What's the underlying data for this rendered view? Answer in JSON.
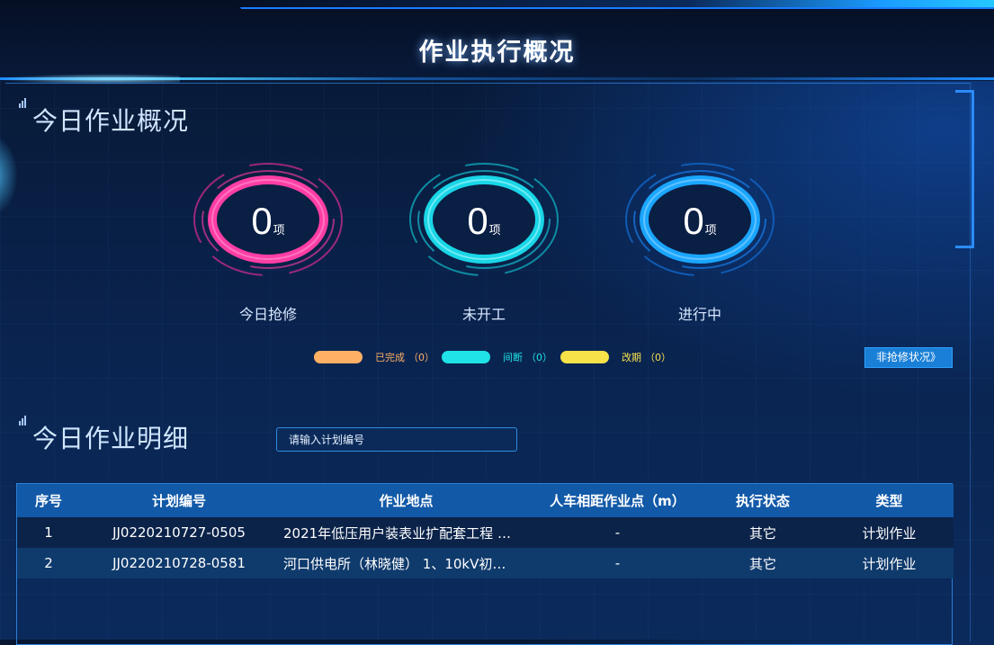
{
  "header": {
    "title": "作业执行概况"
  },
  "overview": {
    "title": "今日作业概况",
    "stats": [
      {
        "value": "0",
        "unit": "项",
        "label": "今日抢修",
        "color": "#ff3ea5"
      },
      {
        "value": "0",
        "unit": "项",
        "label": "未开工",
        "color": "#19d6e6"
      },
      {
        "value": "0",
        "unit": "项",
        "label": "进行中",
        "color": "#1a8bff"
      }
    ],
    "legend": [
      {
        "label": "已完成",
        "count": "（0）",
        "color": "#ffb064"
      },
      {
        "label": "间断",
        "count": "（0）",
        "color": "#1fe3e6"
      },
      {
        "label": "改期",
        "count": "（0）",
        "color": "#f7e24a"
      }
    ],
    "nonrepair_button": "非抢修状况》"
  },
  "detail": {
    "title": "今日作业明细",
    "search_placeholder": "请输入计划编号",
    "columns": [
      "序号",
      "计划编号",
      "作业地点",
      "人车相距作业点（m）",
      "执行状态",
      "类型"
    ],
    "rows": [
      [
        "1",
        "JJ0220210727-0505",
        "2021年低压用户装表业扩配套工程 …",
        "-",
        "其它",
        "计划作业"
      ],
      [
        "2",
        "JJ0220210728-0581",
        "河口供电所（林晓健） 1、10kV初…",
        "-",
        "其它",
        "计划作业"
      ]
    ]
  }
}
